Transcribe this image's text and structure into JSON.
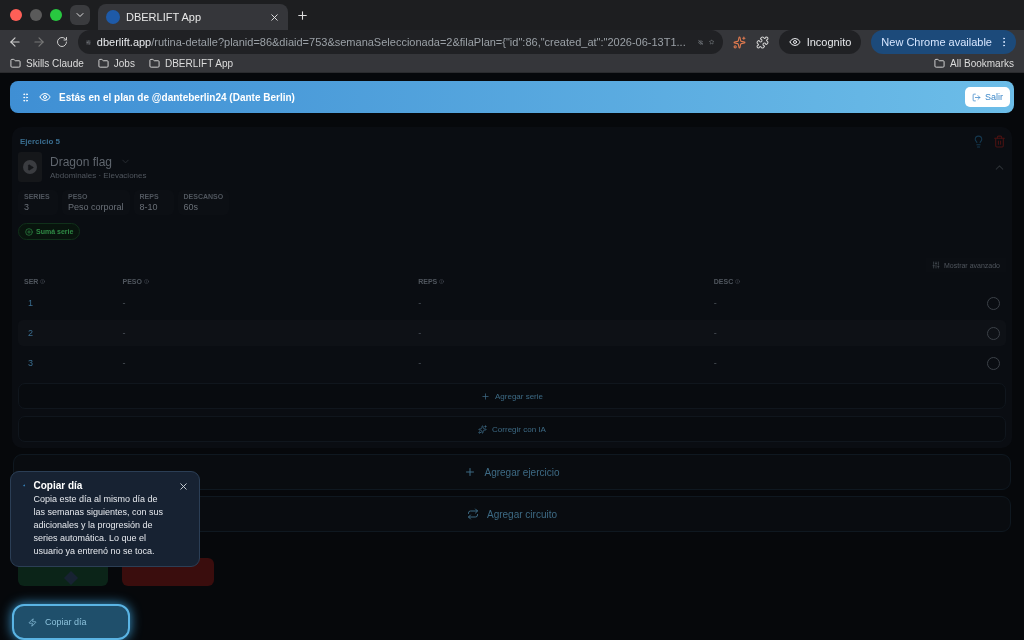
{
  "browser": {
    "tabs": [
      {
        "title": "DBERLIFT App",
        "selected": true
      }
    ],
    "url_host": "dberlift.app",
    "url_path": "/rutina-detalle?planid=86&diaid=753&semanaSeleccionada=2&filaPlan={\"id\":86,\"created_at\":\"2026-06-13T1...",
    "profile": "Incognito",
    "update": "New Chrome available",
    "bookmarks": [
      "Skills Claude",
      "Jobs",
      "DBERLIFT App"
    ],
    "all_bookmarks": "All Bookmarks"
  },
  "banner": {
    "text": "Estás en el plan de @danteberlin24 (Dante Berlin)",
    "button": "Salir"
  },
  "exercise": {
    "label": "Ejercicio 5",
    "name": "Dragon flag",
    "subtitle": "Abdominales · Elevaciones",
    "expanded": true,
    "stats": [
      {
        "label": "SERIES",
        "value": "3"
      },
      {
        "label": "PESO",
        "value": "Peso corporal"
      },
      {
        "label": "REPS",
        "value": "8-10"
      },
      {
        "label": "DESCANSO",
        "value": "60s"
      }
    ],
    "add_chip": "Sumá serie",
    "advanced": "Mostrar avanzado",
    "columns": [
      "SER",
      "PESO",
      "REPS",
      "DESC"
    ],
    "rows": [
      {
        "cells": [
          "1",
          "-",
          "-",
          "-"
        ],
        "done": false
      },
      {
        "cells": [
          "2",
          "-",
          "-",
          "-"
        ],
        "done": false
      },
      {
        "cells": [
          "3",
          "-",
          "-",
          "-"
        ],
        "done": false
      }
    ],
    "add_set": "Agregar serie",
    "ai_fix": "Corregir con IA"
  },
  "actions": [
    {
      "kind": "add",
      "label": "Agregar ejercicio"
    },
    {
      "kind": "circuit",
      "label": "Agregar circuito"
    }
  ],
  "tooltip": {
    "title": "Copiar día",
    "body": "Copia este día al mismo día de las semanas siguientes, con sus adicionales y la progresión de series automática. Lo que el usuario ya entrenó no se toca."
  },
  "copy_button": "Copiar día"
}
